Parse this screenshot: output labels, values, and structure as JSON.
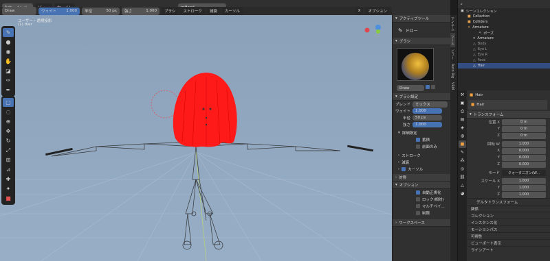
{
  "header": {
    "mode": "ウェイトペ...",
    "tool_name": "Draw",
    "menu_view": "ビュー",
    "menu_weight": "ウェイト",
    "weight_label": "ウェイト",
    "weight_value": "1.000",
    "radius_label": "半径",
    "radius_value": "50 px",
    "strength_label": "強さ",
    "strength_value": "1.000",
    "brush_menu": "ブラシ",
    "stroke_menu": "ストローク",
    "falloff_menu": "減衰",
    "cursor_menu": "カーソル",
    "object_name": "mHead",
    "options_label": "オプション",
    "x_label": "X"
  },
  "viewport": {
    "view_name": "ユーザー・透視投影",
    "object_label": "(1) Hair"
  },
  "npanel": {
    "active_tool": "アクティブツール",
    "tool_draw": "ドロー",
    "brush_header": "ブラシ",
    "brush_name": "Draw",
    "brush_settings": "ブラシ設定",
    "blend_label": "ブレンド",
    "blend_value": "ミックス",
    "weight_label": "ウェイト",
    "weight_value": "1.000",
    "radius_label": "半径",
    "radius_value": "50 px",
    "strength_label": "強さ",
    "strength_value": "1.000",
    "advanced": "詳細設定",
    "accumulate": "蓄積",
    "front_only": "前面のみ",
    "stroke": "ストローク",
    "falloff": "減衰",
    "cursor": "カーソル",
    "symmetry": "対称",
    "options": "オプション",
    "auto_normalize": "自動正規化",
    "lock_relative": "ロック(相対)",
    "multipaint": "マルチペイ...",
    "restrict": "制限",
    "workspace": "ワークスペース"
  },
  "sidetabs": [
    "アイテム",
    "ツール",
    "ビュー",
    "Auto Rig",
    "VRM"
  ],
  "outliner": {
    "scene_collection": "シーンコレクション",
    "items": [
      {
        "name": "Collection",
        "indent": 1
      },
      {
        "name": "Colliders",
        "indent": 1
      },
      {
        "name": "Armature",
        "indent": 1
      },
      {
        "name": "ポーズ",
        "indent": 3
      },
      {
        "name": "Armature",
        "indent": 2
      },
      {
        "name": "Body",
        "indent": 2
      },
      {
        "name": "Eye L",
        "indent": 2
      },
      {
        "name": "Eye R",
        "indent": 2
      },
      {
        "name": "Face",
        "indent": 2
      },
      {
        "name": "Hair",
        "indent": 2,
        "selected": true
      }
    ]
  },
  "properties": {
    "object_name": "Hair",
    "data_name": "Hair",
    "transform": "トランスフォーム",
    "location_label": "位置 X",
    "location": [
      "0 m",
      "0 m",
      "0 m"
    ],
    "rotation_label": "回転 W",
    "rotation": [
      "1.000",
      "0.000",
      "0.000",
      "0.000"
    ],
    "mode_label": "モード",
    "mode_value": "クォータニオン(W...",
    "scale_label": "スケール X",
    "scale": [
      "1.000",
      "1.000",
      "1.000"
    ],
    "axis_y": "Y",
    "axis_z": "Z",
    "axis_x": "X",
    "delta": "デルタトランスフォーム",
    "sections": [
      "関係",
      "コレクション",
      "インスタンス化",
      "モーションパス",
      "可視性",
      "ビューポート表示",
      "ラインアート"
    ]
  },
  "colors": {
    "accent": "#4772b3",
    "hair": "#ff1a1a",
    "viewport_bg": "#8fa6bf"
  }
}
